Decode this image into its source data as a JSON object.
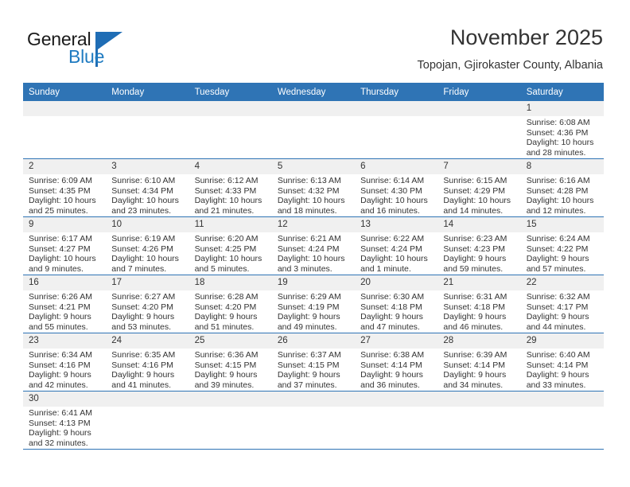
{
  "brand": {
    "name_part1": "General",
    "name_part2": "Blue",
    "accent_color": "#1f7bc1",
    "triangle_color": "#1f6db5"
  },
  "header": {
    "title": "November 2025",
    "subtitle": "Topojan, Gjirokaster County, Albania"
  },
  "theme": {
    "header_blue": "#2f74b5",
    "daynum_gray": "#f0f0f0",
    "text_color": "#333333"
  },
  "weekday_headers": [
    "Sunday",
    "Monday",
    "Tuesday",
    "Wednesday",
    "Thursday",
    "Friday",
    "Saturday"
  ],
  "labels": {
    "sunrise_prefix": "Sunrise:",
    "sunset_prefix": "Sunset:",
    "daylight_prefix": "Daylight:"
  },
  "weeks": [
    [
      {
        "day": "",
        "blank": true,
        "sunrise": "",
        "sunset": "",
        "daylight_l1": "",
        "daylight_l2": ""
      },
      {
        "day": "",
        "blank": true,
        "sunrise": "",
        "sunset": "",
        "daylight_l1": "",
        "daylight_l2": ""
      },
      {
        "day": "",
        "blank": true,
        "sunrise": "",
        "sunset": "",
        "daylight_l1": "",
        "daylight_l2": ""
      },
      {
        "day": "",
        "blank": true,
        "sunrise": "",
        "sunset": "",
        "daylight_l1": "",
        "daylight_l2": ""
      },
      {
        "day": "",
        "blank": true,
        "sunrise": "",
        "sunset": "",
        "daylight_l1": "",
        "daylight_l2": ""
      },
      {
        "day": "",
        "blank": true,
        "sunrise": "",
        "sunset": "",
        "daylight_l1": "",
        "daylight_l2": ""
      },
      {
        "day": "1",
        "sunrise": "Sunrise: 6:08 AM",
        "sunset": "Sunset: 4:36 PM",
        "daylight_l1": "Daylight: 10 hours",
        "daylight_l2": "and 28 minutes."
      }
    ],
    [
      {
        "day": "2",
        "sunrise": "Sunrise: 6:09 AM",
        "sunset": "Sunset: 4:35 PM",
        "daylight_l1": "Daylight: 10 hours",
        "daylight_l2": "and 25 minutes."
      },
      {
        "day": "3",
        "sunrise": "Sunrise: 6:10 AM",
        "sunset": "Sunset: 4:34 PM",
        "daylight_l1": "Daylight: 10 hours",
        "daylight_l2": "and 23 minutes."
      },
      {
        "day": "4",
        "sunrise": "Sunrise: 6:12 AM",
        "sunset": "Sunset: 4:33 PM",
        "daylight_l1": "Daylight: 10 hours",
        "daylight_l2": "and 21 minutes."
      },
      {
        "day": "5",
        "sunrise": "Sunrise: 6:13 AM",
        "sunset": "Sunset: 4:32 PM",
        "daylight_l1": "Daylight: 10 hours",
        "daylight_l2": "and 18 minutes."
      },
      {
        "day": "6",
        "sunrise": "Sunrise: 6:14 AM",
        "sunset": "Sunset: 4:30 PM",
        "daylight_l1": "Daylight: 10 hours",
        "daylight_l2": "and 16 minutes."
      },
      {
        "day": "7",
        "sunrise": "Sunrise: 6:15 AM",
        "sunset": "Sunset: 4:29 PM",
        "daylight_l1": "Daylight: 10 hours",
        "daylight_l2": "and 14 minutes."
      },
      {
        "day": "8",
        "sunrise": "Sunrise: 6:16 AM",
        "sunset": "Sunset: 4:28 PM",
        "daylight_l1": "Daylight: 10 hours",
        "daylight_l2": "and 12 minutes."
      }
    ],
    [
      {
        "day": "9",
        "sunrise": "Sunrise: 6:17 AM",
        "sunset": "Sunset: 4:27 PM",
        "daylight_l1": "Daylight: 10 hours",
        "daylight_l2": "and 9 minutes."
      },
      {
        "day": "10",
        "sunrise": "Sunrise: 6:19 AM",
        "sunset": "Sunset: 4:26 PM",
        "daylight_l1": "Daylight: 10 hours",
        "daylight_l2": "and 7 minutes."
      },
      {
        "day": "11",
        "sunrise": "Sunrise: 6:20 AM",
        "sunset": "Sunset: 4:25 PM",
        "daylight_l1": "Daylight: 10 hours",
        "daylight_l2": "and 5 minutes."
      },
      {
        "day": "12",
        "sunrise": "Sunrise: 6:21 AM",
        "sunset": "Sunset: 4:24 PM",
        "daylight_l1": "Daylight: 10 hours",
        "daylight_l2": "and 3 minutes."
      },
      {
        "day": "13",
        "sunrise": "Sunrise: 6:22 AM",
        "sunset": "Sunset: 4:24 PM",
        "daylight_l1": "Daylight: 10 hours",
        "daylight_l2": "and 1 minute."
      },
      {
        "day": "14",
        "sunrise": "Sunrise: 6:23 AM",
        "sunset": "Sunset: 4:23 PM",
        "daylight_l1": "Daylight: 9 hours",
        "daylight_l2": "and 59 minutes."
      },
      {
        "day": "15",
        "sunrise": "Sunrise: 6:24 AM",
        "sunset": "Sunset: 4:22 PM",
        "daylight_l1": "Daylight: 9 hours",
        "daylight_l2": "and 57 minutes."
      }
    ],
    [
      {
        "day": "16",
        "sunrise": "Sunrise: 6:26 AM",
        "sunset": "Sunset: 4:21 PM",
        "daylight_l1": "Daylight: 9 hours",
        "daylight_l2": "and 55 minutes."
      },
      {
        "day": "17",
        "sunrise": "Sunrise: 6:27 AM",
        "sunset": "Sunset: 4:20 PM",
        "daylight_l1": "Daylight: 9 hours",
        "daylight_l2": "and 53 minutes."
      },
      {
        "day": "18",
        "sunrise": "Sunrise: 6:28 AM",
        "sunset": "Sunset: 4:20 PM",
        "daylight_l1": "Daylight: 9 hours",
        "daylight_l2": "and 51 minutes."
      },
      {
        "day": "19",
        "sunrise": "Sunrise: 6:29 AM",
        "sunset": "Sunset: 4:19 PM",
        "daylight_l1": "Daylight: 9 hours",
        "daylight_l2": "and 49 minutes."
      },
      {
        "day": "20",
        "sunrise": "Sunrise: 6:30 AM",
        "sunset": "Sunset: 4:18 PM",
        "daylight_l1": "Daylight: 9 hours",
        "daylight_l2": "and 47 minutes."
      },
      {
        "day": "21",
        "sunrise": "Sunrise: 6:31 AM",
        "sunset": "Sunset: 4:18 PM",
        "daylight_l1": "Daylight: 9 hours",
        "daylight_l2": "and 46 minutes."
      },
      {
        "day": "22",
        "sunrise": "Sunrise: 6:32 AM",
        "sunset": "Sunset: 4:17 PM",
        "daylight_l1": "Daylight: 9 hours",
        "daylight_l2": "and 44 minutes."
      }
    ],
    [
      {
        "day": "23",
        "sunrise": "Sunrise: 6:34 AM",
        "sunset": "Sunset: 4:16 PM",
        "daylight_l1": "Daylight: 9 hours",
        "daylight_l2": "and 42 minutes."
      },
      {
        "day": "24",
        "sunrise": "Sunrise: 6:35 AM",
        "sunset": "Sunset: 4:16 PM",
        "daylight_l1": "Daylight: 9 hours",
        "daylight_l2": "and 41 minutes."
      },
      {
        "day": "25",
        "sunrise": "Sunrise: 6:36 AM",
        "sunset": "Sunset: 4:15 PM",
        "daylight_l1": "Daylight: 9 hours",
        "daylight_l2": "and 39 minutes."
      },
      {
        "day": "26",
        "sunrise": "Sunrise: 6:37 AM",
        "sunset": "Sunset: 4:15 PM",
        "daylight_l1": "Daylight: 9 hours",
        "daylight_l2": "and 37 minutes."
      },
      {
        "day": "27",
        "sunrise": "Sunrise: 6:38 AM",
        "sunset": "Sunset: 4:14 PM",
        "daylight_l1": "Daylight: 9 hours",
        "daylight_l2": "and 36 minutes."
      },
      {
        "day": "28",
        "sunrise": "Sunrise: 6:39 AM",
        "sunset": "Sunset: 4:14 PM",
        "daylight_l1": "Daylight: 9 hours",
        "daylight_l2": "and 34 minutes."
      },
      {
        "day": "29",
        "sunrise": "Sunrise: 6:40 AM",
        "sunset": "Sunset: 4:14 PM",
        "daylight_l1": "Daylight: 9 hours",
        "daylight_l2": "and 33 minutes."
      }
    ],
    [
      {
        "day": "30",
        "sunrise": "Sunrise: 6:41 AM",
        "sunset": "Sunset: 4:13 PM",
        "daylight_l1": "Daylight: 9 hours",
        "daylight_l2": "and 32 minutes."
      },
      {
        "day": "",
        "blank": true,
        "sunrise": "",
        "sunset": "",
        "daylight_l1": "",
        "daylight_l2": ""
      },
      {
        "day": "",
        "blank": true,
        "sunrise": "",
        "sunset": "",
        "daylight_l1": "",
        "daylight_l2": ""
      },
      {
        "day": "",
        "blank": true,
        "sunrise": "",
        "sunset": "",
        "daylight_l1": "",
        "daylight_l2": ""
      },
      {
        "day": "",
        "blank": true,
        "sunrise": "",
        "sunset": "",
        "daylight_l1": "",
        "daylight_l2": ""
      },
      {
        "day": "",
        "blank": true,
        "sunrise": "",
        "sunset": "",
        "daylight_l1": "",
        "daylight_l2": ""
      },
      {
        "day": "",
        "blank": true,
        "sunrise": "",
        "sunset": "",
        "daylight_l1": "",
        "daylight_l2": ""
      }
    ]
  ]
}
